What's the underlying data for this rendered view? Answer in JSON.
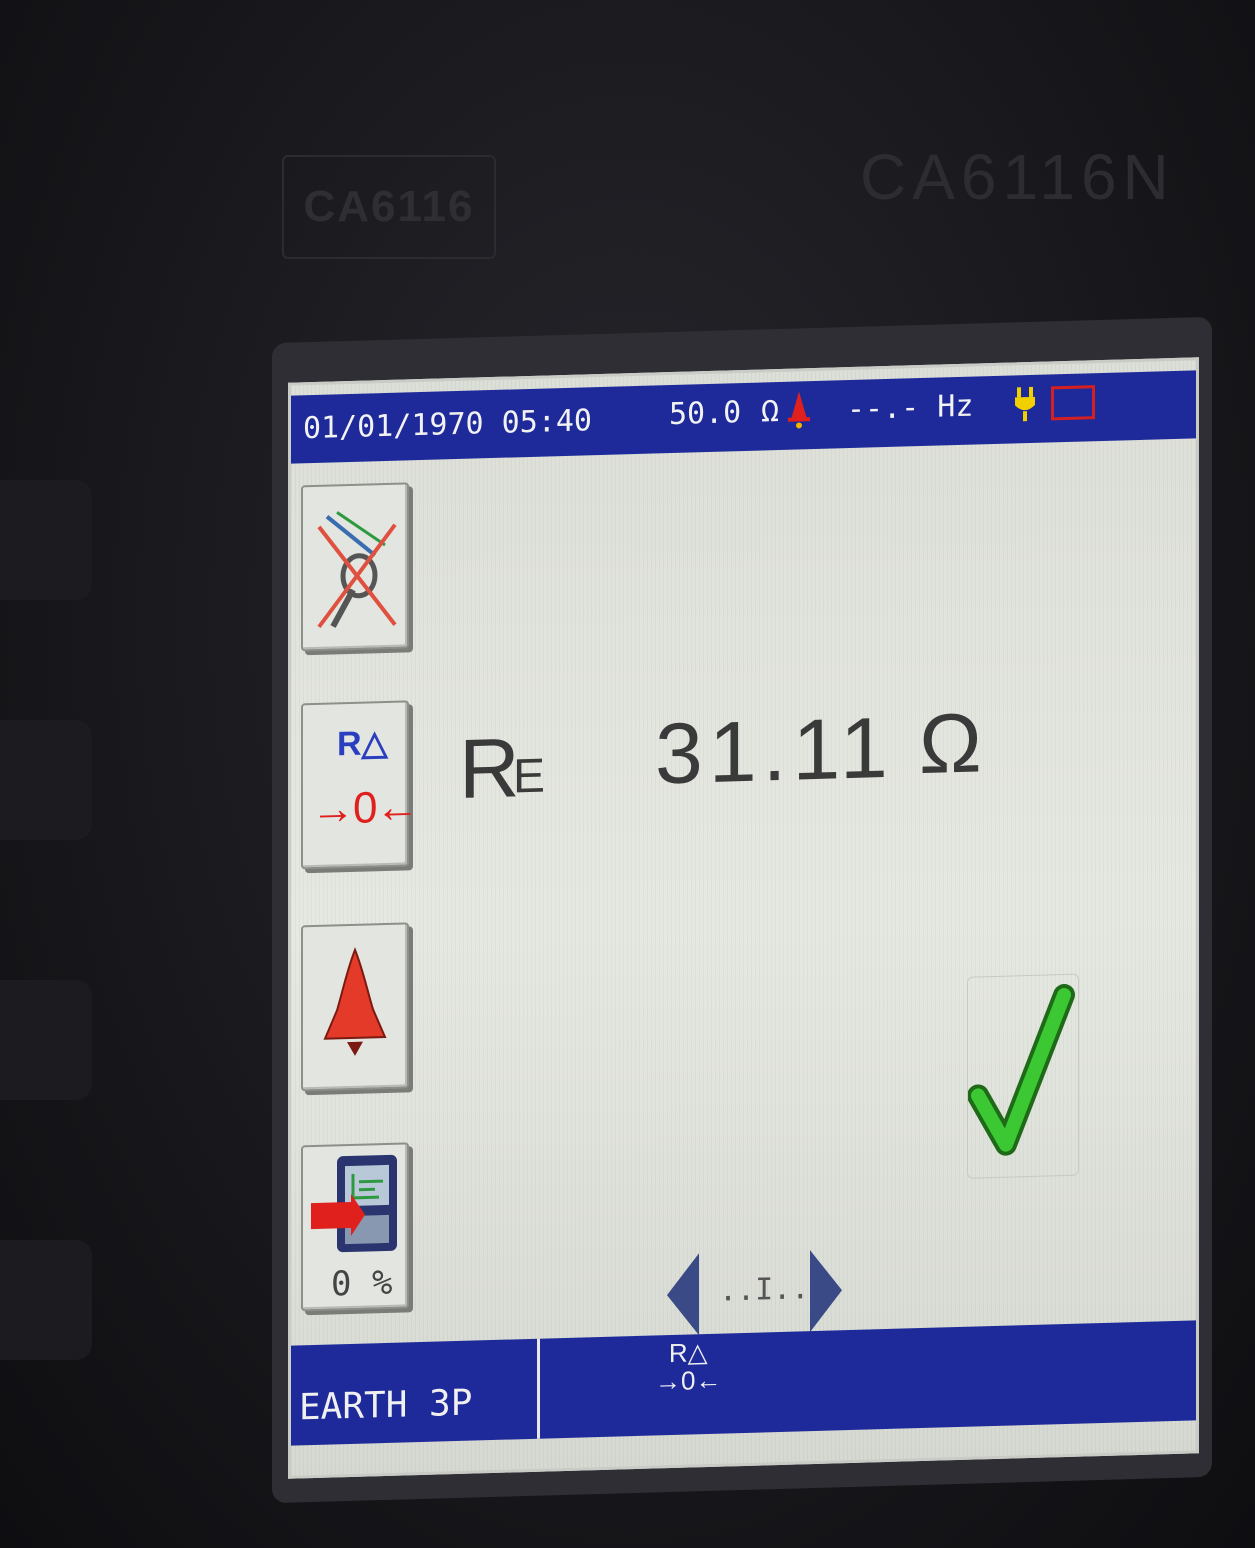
{
  "device": {
    "brand": "CA6116N",
    "label_box": "CA6116"
  },
  "status_bar": {
    "datetime": "01/01/1970 05:40",
    "voltage_value": "50.0",
    "voltage_unit": "Ω",
    "frequency": "--.- Hz",
    "icons": [
      "alarm-bell-icon",
      "plug-icon",
      "battery-icon"
    ]
  },
  "side_buttons": [
    {
      "name": "no-clamp-probe",
      "icon": "crossed-clamp-icon"
    },
    {
      "name": "compensation",
      "r_label": "R△",
      "zero_label": "→0←"
    },
    {
      "name": "alarm",
      "icon": "bell-icon"
    },
    {
      "name": "memory",
      "percent": "0 %"
    }
  ],
  "measurement": {
    "label_main": "R",
    "label_sub": "E",
    "value": "31.11",
    "unit": "Ω",
    "status": "check-ok-icon"
  },
  "navigation": {
    "middle": "..I.."
  },
  "bottom_bar": {
    "mode": "EARTH 3P",
    "function_key": "R△\n→0←"
  },
  "colors": {
    "bar_blue": "#1f2a9a",
    "alarm_red": "#e0201c",
    "check_green": "#33c02a",
    "screen_bg": "#dfe3dc"
  }
}
